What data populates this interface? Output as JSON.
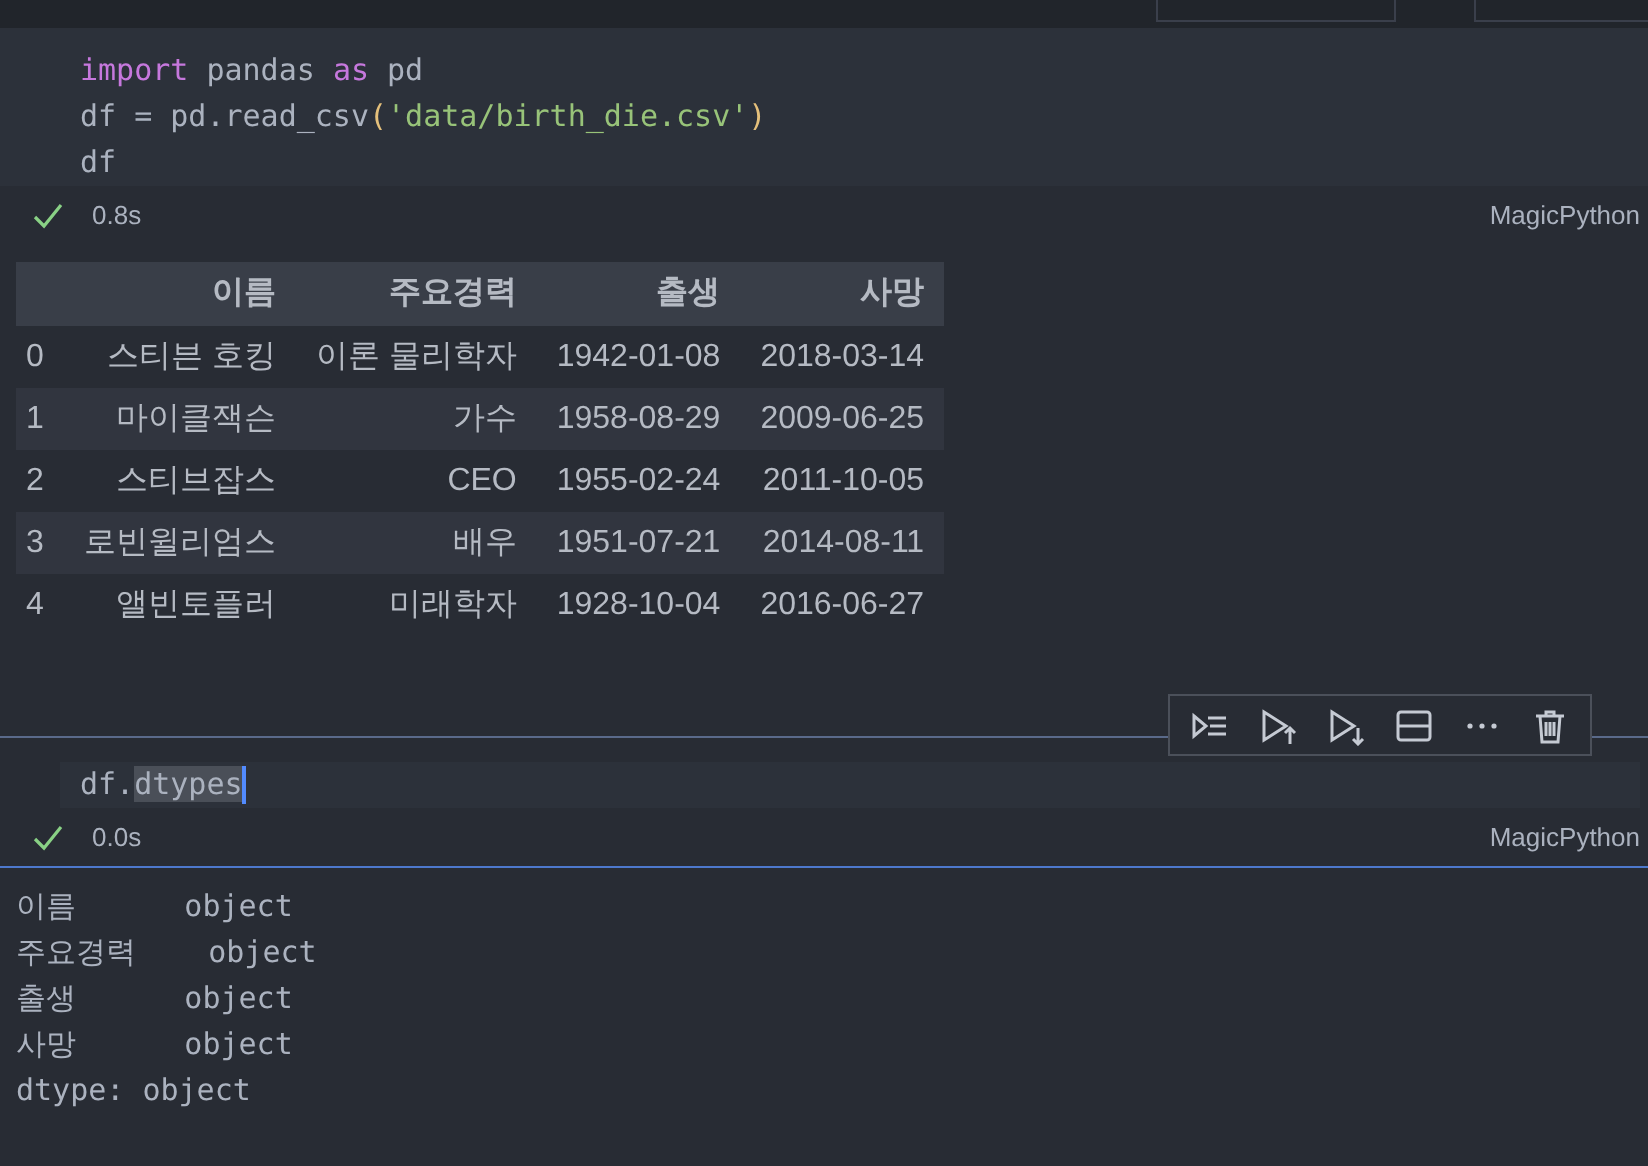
{
  "cells": [
    {
      "selected": false,
      "code": [
        [
          {
            "kind": "keyword",
            "text": "import"
          },
          {
            "kind": "plain",
            "text": " pandas "
          },
          {
            "kind": "keyword",
            "text": "as"
          },
          {
            "kind": "plain",
            "text": " pd"
          }
        ],
        [
          {
            "kind": "plain",
            "text": "df = pd.read_csv"
          },
          {
            "kind": "bracket",
            "text": "("
          },
          {
            "kind": "string",
            "text": "'data/birth_die.csv'"
          },
          {
            "kind": "bracket",
            "text": ")"
          }
        ],
        [
          {
            "kind": "plain",
            "text": "df"
          }
        ]
      ],
      "status": {
        "time": "0.8s",
        "language": "MagicPython"
      },
      "output": {
        "kind": "table",
        "columns": [
          "",
          "이름",
          "주요경력",
          "출생",
          "사망"
        ],
        "rows": [
          [
            "0",
            "스티븐 호킹",
            "이론 물리학자",
            "1942-01-08",
            "2018-03-14"
          ],
          [
            "1",
            "마이클잭슨",
            "가수",
            "1958-08-29",
            "2009-06-25"
          ],
          [
            "2",
            "스티브잡스",
            "CEO",
            "1955-02-24",
            "2011-10-05"
          ],
          [
            "3",
            "로빈윌리엄스",
            "배우",
            "1951-07-21",
            "2014-08-11"
          ],
          [
            "4",
            "앨빈토플러",
            "미래학자",
            "1928-10-04",
            "2016-06-27"
          ]
        ]
      }
    },
    {
      "selected": true,
      "code": [
        [
          {
            "kind": "plain",
            "text": "df."
          },
          {
            "kind": "selection",
            "text": "dtypes"
          }
        ]
      ],
      "status": {
        "time": "0.0s",
        "language": "MagicPython"
      },
      "output": {
        "kind": "text",
        "lines": [
          "이름      object",
          "주요경력    object",
          "출생      object",
          "사망      object",
          "dtype: object"
        ]
      }
    }
  ]
}
